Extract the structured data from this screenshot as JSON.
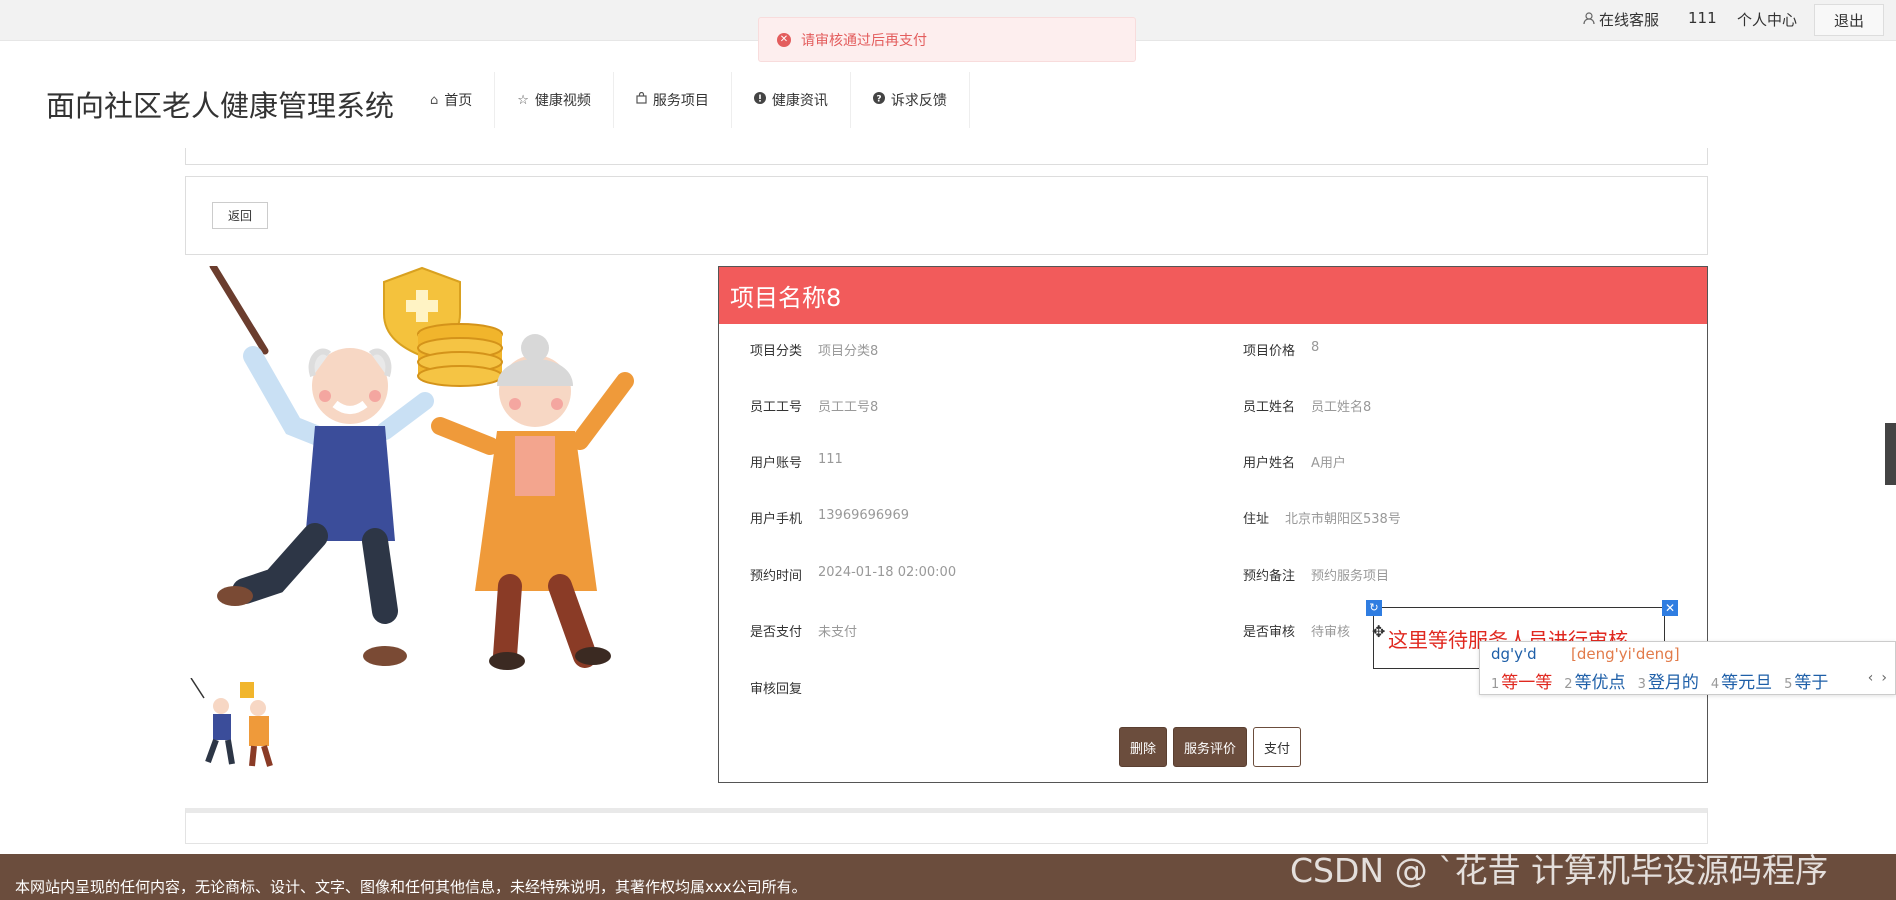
{
  "topbar": {
    "service_label": "在线客服",
    "user_label": "111",
    "center_label": "个人中心",
    "logout_label": "退出"
  },
  "toast": {
    "message": "请审核通过后再支付",
    "icon": "error-icon",
    "color": "#e35d5d"
  },
  "header": {
    "site_title": "面向社区老人健康管理系统",
    "nav": [
      {
        "label": "首页",
        "icon": "home-icon"
      },
      {
        "label": "健康视频",
        "icon": "star-icon"
      },
      {
        "label": "服务项目",
        "icon": "bag-icon"
      },
      {
        "label": "健康资讯",
        "icon": "info-icon"
      },
      {
        "label": "诉求反馈",
        "icon": "question-icon"
      }
    ]
  },
  "back_label": "返回",
  "detail": {
    "title": "项目名称8",
    "header_color": "#f25b5b",
    "fields": {
      "category": {
        "label": "项目分类",
        "value": "项目分类8"
      },
      "price": {
        "label": "项目价格",
        "value": "8"
      },
      "emp_no": {
        "label": "员工工号",
        "value": "员工工号8"
      },
      "emp_name": {
        "label": "员工姓名",
        "value": "员工姓名8"
      },
      "account": {
        "label": "用户账号",
        "value": "111"
      },
      "user_name": {
        "label": "用户姓名",
        "value": "A用户"
      },
      "phone": {
        "label": "用户手机",
        "value": "13969696969"
      },
      "address": {
        "label": "住址",
        "value": "北京市朝阳区538号"
      },
      "time": {
        "label": "预约时间",
        "value": "2024-01-18 02:00:00"
      },
      "remark": {
        "label": "预约备注",
        "value": "预约服务项目"
      },
      "paid": {
        "label": "是否支付",
        "value": "未支付"
      },
      "reviewed": {
        "label": "是否审核",
        "value": "待审核"
      },
      "reply": {
        "label": "审核回复",
        "value": ""
      }
    },
    "buttons": {
      "delete": "删除",
      "review": "服务评价",
      "pay": "支付"
    }
  },
  "annotation": {
    "text": "这里等待服务人员进行审核"
  },
  "ime": {
    "input": "dg'y'd",
    "pinyin": "[deng'yi'deng]",
    "candidates": [
      {
        "num": "1",
        "text": "等一等"
      },
      {
        "num": "2",
        "text": "等优点"
      },
      {
        "num": "3",
        "text": "登月的"
      },
      {
        "num": "4",
        "text": "等元旦"
      },
      {
        "num": "5",
        "text": "等于"
      }
    ],
    "prev": "‹",
    "next": "›"
  },
  "footer": {
    "text": "本网站内呈现的任何内容，无论商标、设计、文字、图像和任何其他信息，未经特殊说明，其著作权均属xxx公司所有。",
    "watermark": "CSDN @ `花昔 计算机毕设源码程序",
    "color": "#6b4d3d"
  }
}
